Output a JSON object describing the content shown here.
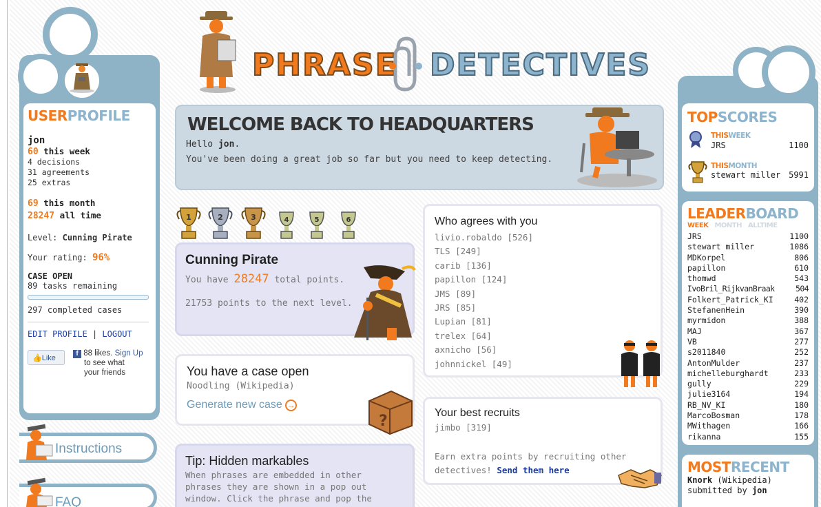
{
  "logo": {
    "part1": "PHRASE",
    "part2": "DETECTIVES"
  },
  "profile": {
    "header_o": "USER",
    "header_b": "PROFILE",
    "username": "jon",
    "week_points": "60",
    "week_label": "this week",
    "decisions": "4 decisions",
    "agreements": "31 agreements",
    "extras": "25 extras",
    "month_points": "69",
    "month_label": "this month",
    "all_points": "28247",
    "all_label": "all time",
    "level_label": "Level:",
    "level": "Cunning Pirate",
    "rating_label": "Your rating:",
    "rating": "96%",
    "case_status": "CASE OPEN",
    "tasks_remaining": "89 tasks remaining",
    "completed": "297 completed cases",
    "edit": "EDIT PROFILE",
    "sep": "|",
    "logout": "LOGOUT",
    "like": "Like",
    "fb_count": "88 likes.",
    "signup": "Sign Up",
    "fb_text1": "to see what",
    "fb_text2": "your friends"
  },
  "nav": {
    "instructions": "Instructions",
    "faq": "FAQ"
  },
  "welcome": {
    "title": "WELCOME BACK TO HEADQUARTERS",
    "hello": "Hello",
    "user": "jon",
    "dot": ".",
    "message": "You've been doing a great job so far but you need to keep detecting."
  },
  "trophies": [
    "1",
    "2",
    "3",
    "4",
    "5",
    "6"
  ],
  "level_card": {
    "title": "Cunning Pirate",
    "you_have": "You have",
    "points": "28247",
    "total": "total points.",
    "next": "21753 points to the next level."
  },
  "case_card": {
    "title": "You have a case open",
    "doc": "Noodling (Wikipedia)",
    "generate": "Generate new case"
  },
  "tip_card": {
    "title": "Tip: Hidden markables",
    "line1": "When phrases are embedded in other",
    "line2": "phrases they are shown in a pop out",
    "line3": "window. Click the phrase and pop the"
  },
  "agrees": {
    "title": "Who agrees with you",
    "items": [
      "livio.robaldo [526]",
      "TLS [249]",
      "carib [136]",
      "papillon [124]",
      "JMS [89]",
      "JRS [85]",
      "Lupian [81]",
      "trelex [64]",
      "axnicho [56]",
      "johnnickel [49]"
    ]
  },
  "recruits": {
    "title": "Your best recruits",
    "item": "jimbo [319]",
    "text1": "Earn extra points by recruiting other",
    "text2": "detectives!",
    "link": "Send them here"
  },
  "topscores": {
    "header_o": "TOP",
    "header_b": "SCORES",
    "this1": "THIS",
    "week": "WEEK",
    "week_name": "JRS",
    "week_score": "1100",
    "this2": "THIS",
    "month": "MONTH",
    "month_name": "stewart miller",
    "month_score": "5991"
  },
  "leaderboard": {
    "header_o": "LEADER",
    "header_b": "BOARD",
    "tab_week": "WEEK",
    "tab_month": "MONTH",
    "tab_all": "ALLTIME",
    "rows": [
      [
        "JRS",
        "1100"
      ],
      [
        "stewart miller",
        "1086"
      ],
      [
        "MDKorpel",
        "806"
      ],
      [
        "papillon",
        "610"
      ],
      [
        "thomwd",
        "543"
      ],
      [
        "IvoBril_RijkvanBraak",
        "504"
      ],
      [
        "Folkert_Patrick_KI",
        "402"
      ],
      [
        "StefanenHein",
        "390"
      ],
      [
        "myrmidon",
        "388"
      ],
      [
        "MAJ",
        "367"
      ],
      [
        "VB",
        "277"
      ],
      [
        "s2011840",
        "252"
      ],
      [
        "AntonMulder",
        "237"
      ],
      [
        "michelleburghardt",
        "233"
      ],
      [
        "gully",
        "229"
      ],
      [
        "julie3164",
        "194"
      ],
      [
        "RB_NV_KI",
        "180"
      ],
      [
        "MarcoBosman",
        "178"
      ],
      [
        "MWithagen",
        "166"
      ],
      [
        "rikanna",
        "155"
      ]
    ]
  },
  "recent": {
    "header_o": "MOST",
    "header_b": "RECENT",
    "name": "Knork",
    "source": "(Wikipedia)",
    "submitted": "submitted by",
    "user": "jon"
  },
  "colors": {
    "orange": "#f07a1d",
    "blue": "#8fb3c6",
    "purple": "#e4e4f4"
  }
}
